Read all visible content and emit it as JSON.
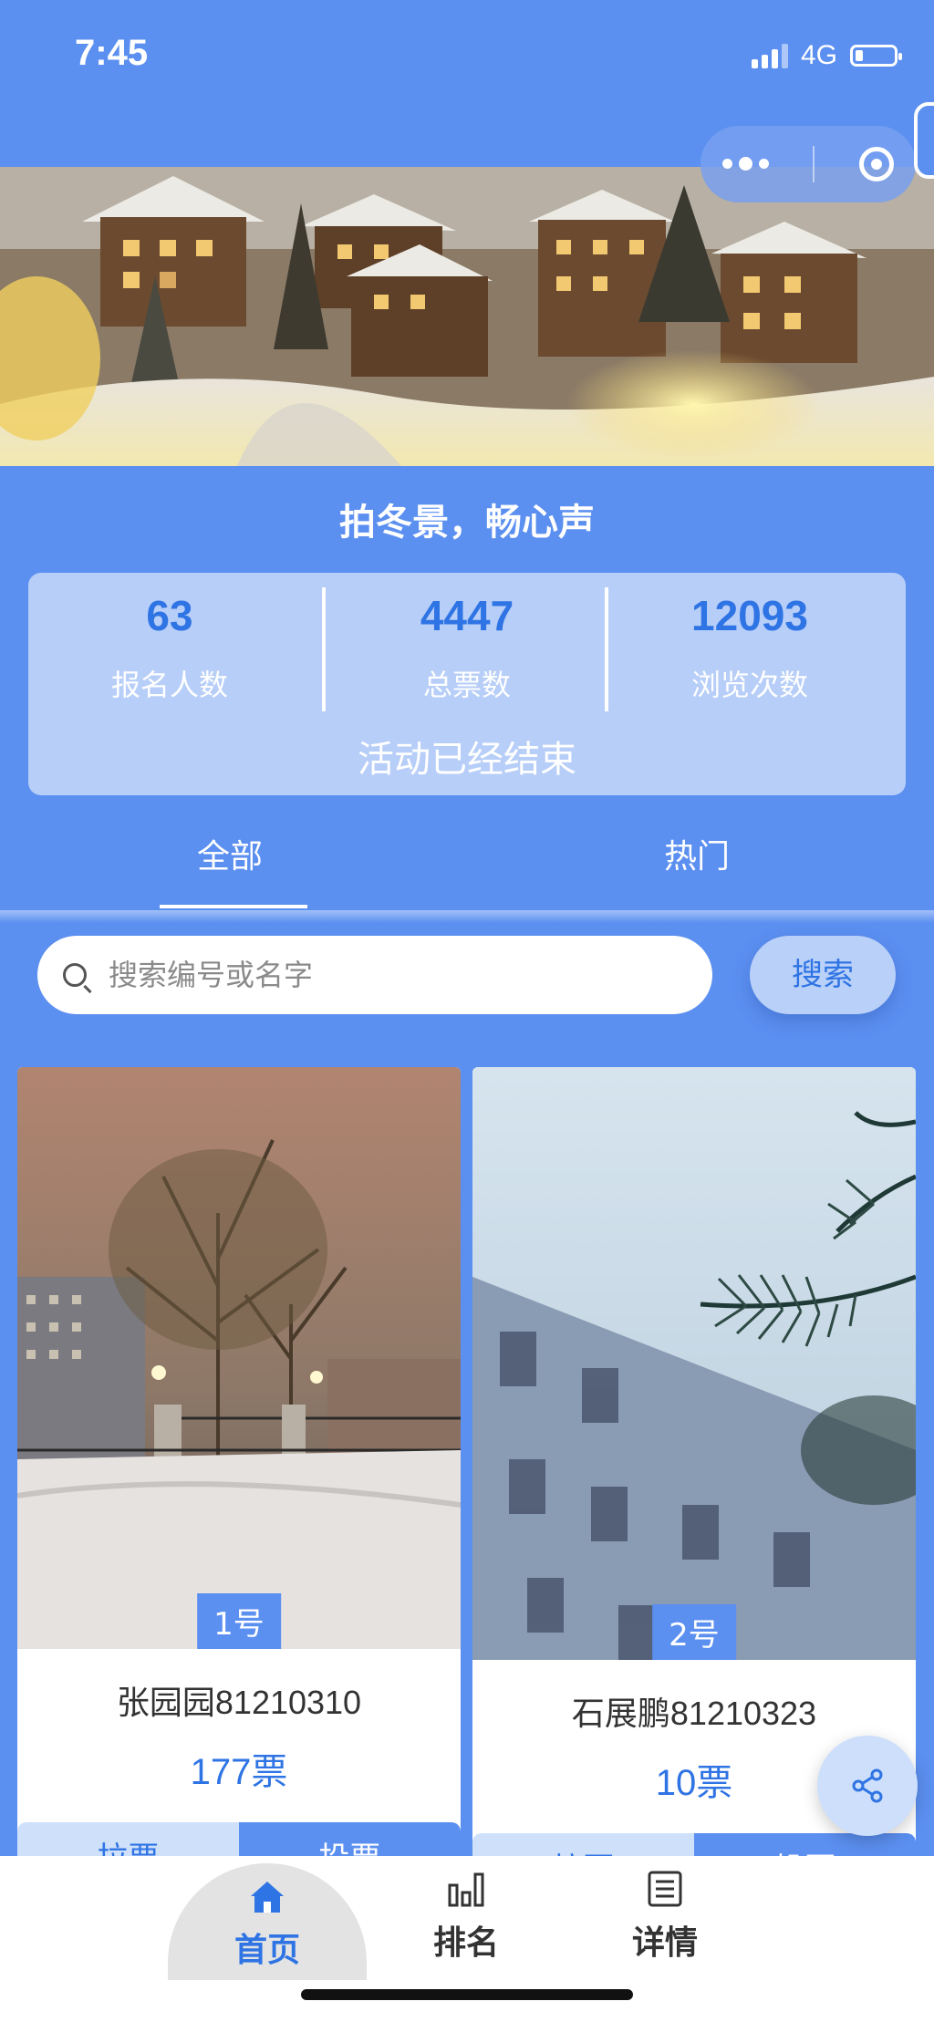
{
  "status_bar": {
    "time": "7:45",
    "network": "4G"
  },
  "capsule": {
    "more_icon": "more-dots-icon",
    "close_icon": "close-target-icon"
  },
  "activity": {
    "title": "拍冬景，畅心声",
    "stats": [
      {
        "value": "63",
        "label": "报名人数"
      },
      {
        "value": "4447",
        "label": "总票数"
      },
      {
        "value": "12093",
        "label": "浏览次数"
      }
    ],
    "status": "活动已经结束"
  },
  "tabs": [
    {
      "label": "全部",
      "active": true
    },
    {
      "label": "热门",
      "active": false
    }
  ],
  "search": {
    "placeholder": "搜索编号或名字",
    "value": "",
    "button_label": "搜索"
  },
  "entries": [
    {
      "number": "1号",
      "name": "张园园81210310",
      "votes": "177票",
      "pull_label": "拉票",
      "vote_label": "投票"
    },
    {
      "number": "2号",
      "name": "石展鹏81210323",
      "votes": "10票",
      "pull_label": "拉票",
      "vote_label": "投票"
    }
  ],
  "share": {
    "icon": "share-icon"
  },
  "bottom_nav": [
    {
      "label": "首页",
      "icon": "home-icon",
      "active": true
    },
    {
      "label": "排名",
      "icon": "bar-chart-icon",
      "active": false
    },
    {
      "label": "详情",
      "icon": "document-icon",
      "active": false
    }
  ],
  "colors": {
    "background": "#5b8ff0",
    "accent": "#2f74e4",
    "card_light": "#b7cef8"
  }
}
